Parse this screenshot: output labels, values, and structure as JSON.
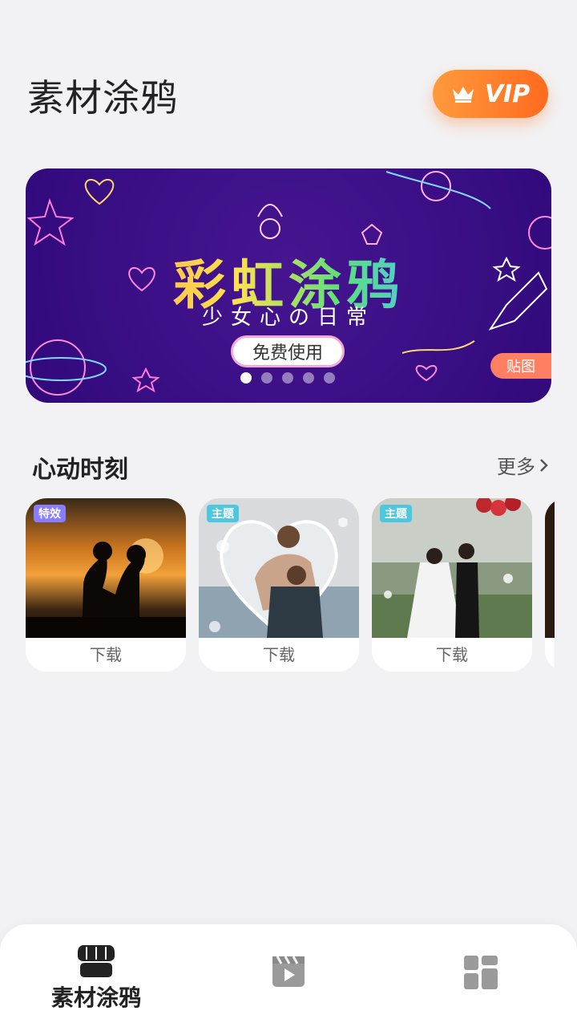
{
  "header": {
    "title": "素材涂鸦",
    "vip_label": "VIP"
  },
  "banner": {
    "headline": "彩虹涂鸦",
    "subtitle": "少女心の日常",
    "cta": "免费使用",
    "tag": "贴图",
    "dots_total": 5,
    "dots_active_index": 0
  },
  "section": {
    "title": "心动时刻",
    "more_label": "更多"
  },
  "cards": [
    {
      "badge": "特效",
      "label": "下载"
    },
    {
      "badge": "主题",
      "label": "下载"
    },
    {
      "badge": "主题",
      "label": "下载"
    }
  ],
  "tabs": [
    {
      "label": "素材涂鸦",
      "icon": "store-icon"
    },
    {
      "label": "",
      "icon": "video-icon"
    },
    {
      "label": "",
      "icon": "grid-icon"
    }
  ],
  "colors": {
    "vip_gradient_start": "#ff9a3c",
    "vip_gradient_end": "#ff6a1f",
    "banner_bg": "#3a0f86",
    "badge_effect": "#8a7cff",
    "badge_theme": "#4cc7de"
  }
}
